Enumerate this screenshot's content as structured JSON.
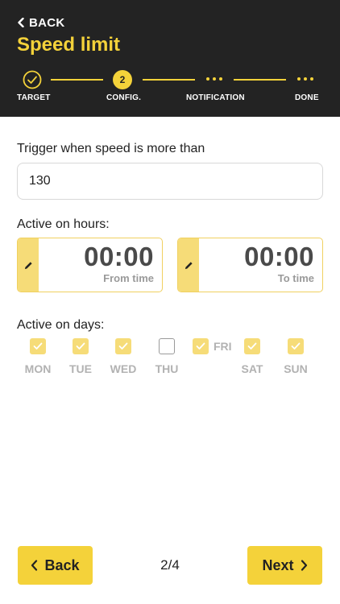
{
  "header": {
    "back_label": "BACK",
    "title": "Speed limit"
  },
  "stepper": {
    "current_step": 2,
    "steps": [
      {
        "label": "TARGET",
        "status": "done"
      },
      {
        "label": "CONFIG.",
        "status": "current",
        "number": "2"
      },
      {
        "label": "NOTIFICATION",
        "status": "pending"
      },
      {
        "label": "DONE",
        "status": "pending"
      }
    ]
  },
  "trigger": {
    "label": "Trigger when speed is more than",
    "value": "130"
  },
  "hours": {
    "label": "Active on hours:",
    "from": {
      "value": "00:00",
      "caption": "From time"
    },
    "to": {
      "value": "00:00",
      "caption": "To time"
    }
  },
  "days": {
    "label": "Active on days:",
    "items": [
      {
        "name": "MON",
        "checked": true
      },
      {
        "name": "TUE",
        "checked": true
      },
      {
        "name": "WED",
        "checked": true
      },
      {
        "name": "THU",
        "checked": false
      },
      {
        "name": "FRI",
        "checked": true
      },
      {
        "name": "SAT",
        "checked": true
      },
      {
        "name": "SUN",
        "checked": true
      }
    ]
  },
  "footer": {
    "back_label": "Back",
    "page_indicator": "2/4",
    "next_label": "Next"
  },
  "colors": {
    "accent": "#f4d23a",
    "header_bg": "#232323",
    "checkbox_on": "#f6dc78"
  }
}
